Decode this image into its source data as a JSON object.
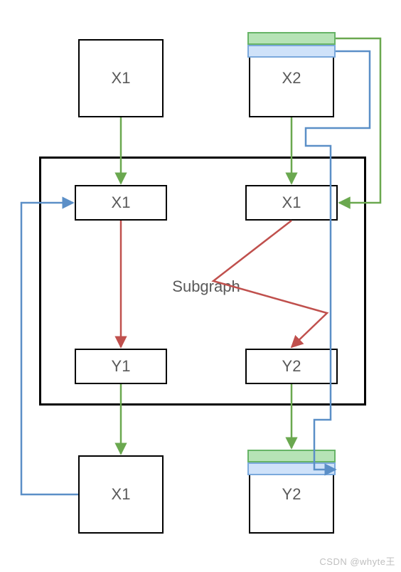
{
  "nodes": {
    "topLeft": "X1",
    "topRight": "X2",
    "subInnerLeft": "X1",
    "subInnerRight": "X1",
    "subBottomLeft": "Y1",
    "subBottomRight": "Y2",
    "outBottomLeft": "X1",
    "outBottomRight": "Y2"
  },
  "labels": {
    "subgraph": "Subgraph"
  },
  "colors": {
    "green": "#6aa84f",
    "blue": "#5b8fc7",
    "red": "#c0504d",
    "greenFill": "#b6e3b6",
    "blueFill": "#cfe2f9"
  },
  "watermark": "CSDN @whyte王"
}
